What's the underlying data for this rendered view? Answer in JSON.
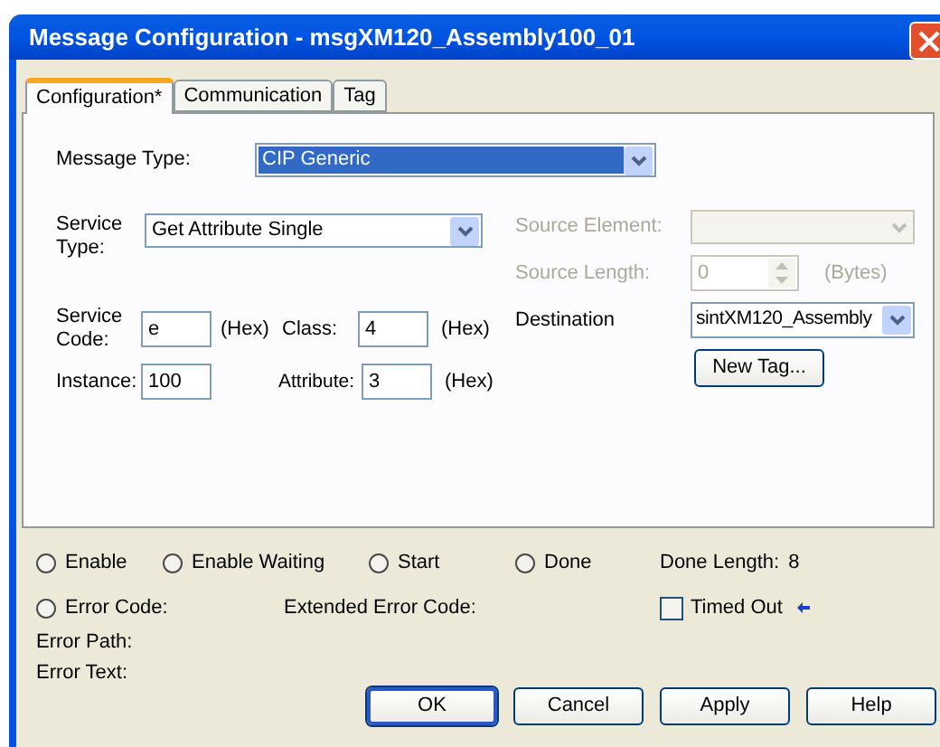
{
  "window": {
    "title": "Message Configuration - msgXM120_Assembly100_01"
  },
  "tabs": [
    {
      "label": "Configuration*",
      "selected": true
    },
    {
      "label": "Communication",
      "selected": false
    },
    {
      "label": "Tag",
      "selected": false
    }
  ],
  "message_type": {
    "label": "Message Type:",
    "value": "CIP Generic"
  },
  "service_type": {
    "label": "Service Type:",
    "value": "Get Attribute Single"
  },
  "service_code": {
    "label": "Service Code:",
    "value": "e",
    "unit": "(Hex)"
  },
  "class": {
    "label": "Class:",
    "value": "4",
    "unit": "(Hex)"
  },
  "instance": {
    "label": "Instance:",
    "value": "100"
  },
  "attribute": {
    "label": "Attribute:",
    "value": "3",
    "unit": "(Hex)"
  },
  "source_element": {
    "label": "Source Element:",
    "disabled": true
  },
  "source_length": {
    "label": "Source Length:",
    "value": "0",
    "unit": "(Bytes)",
    "disabled": true
  },
  "destination": {
    "label": "Destination",
    "value": "sintXM120_Assembly"
  },
  "new_tag_button": {
    "label": "New Tag..."
  },
  "indicators": [
    {
      "label": "Enable",
      "checked": false
    },
    {
      "label": "Enable Waiting",
      "checked": false
    },
    {
      "label": "Start",
      "checked": false
    },
    {
      "label": "Done",
      "checked": false
    }
  ],
  "done_length": {
    "label": "Done Length:",
    "value": "8"
  },
  "error_code": {
    "label": "Error Code:",
    "checked": false
  },
  "extended_error_code": {
    "label": "Extended Error Code:"
  },
  "timed_out": {
    "label": "Timed Out",
    "checked": false
  },
  "error_path": {
    "label": "Error Path:"
  },
  "error_text": {
    "label": "Error Text:"
  },
  "buttons": [
    {
      "label": "OK",
      "default": true
    },
    {
      "label": "Cancel",
      "default": false
    },
    {
      "label": "Apply",
      "default": false
    },
    {
      "label": "Help",
      "default": false
    }
  ]
}
